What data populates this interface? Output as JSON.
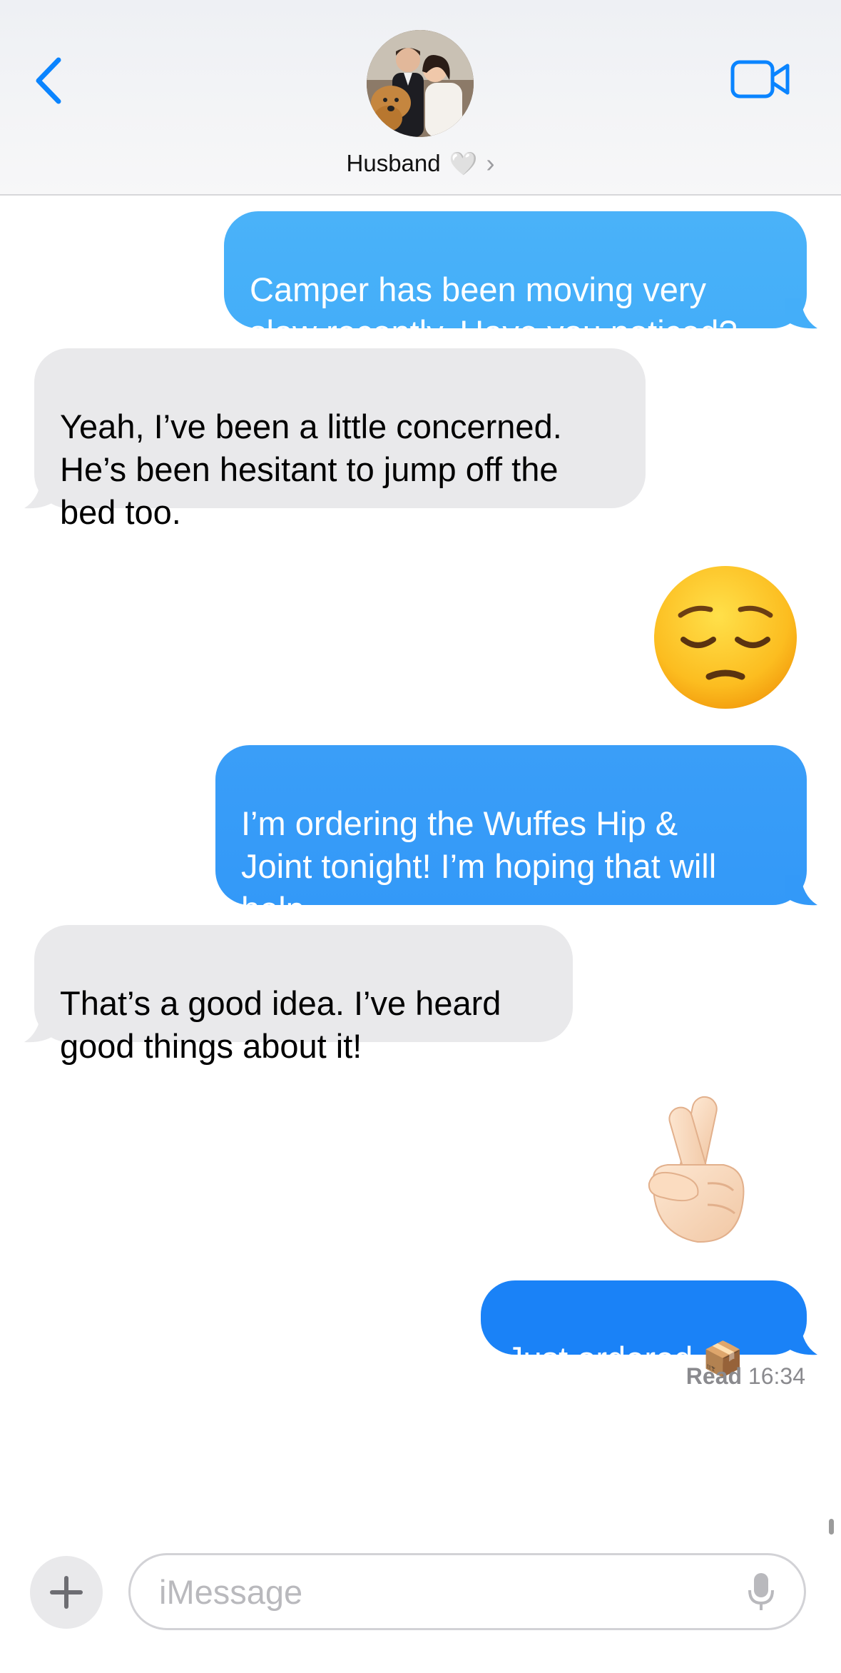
{
  "header": {
    "contact_name": "Husband",
    "contact_heart": "🤍",
    "contact_chevron": "›",
    "back_icon": "chevron-left-icon",
    "video_icon": "video-camera-icon"
  },
  "messages": [
    {
      "sender": "me",
      "text": "Camper has been moving very\nslow recently. Have you noticed?"
    },
    {
      "sender": "them",
      "text": "Yeah, I’ve been a little concerned.\nHe’s been hesitant to jump off the\nbed too."
    },
    {
      "sender": "me",
      "emoji": "😔"
    },
    {
      "sender": "me",
      "text": "I’m ordering the Wuffes Hip &\nJoint tonight! I’m hoping that will\nhelp."
    },
    {
      "sender": "them",
      "text": "That’s a good idea. I’ve heard\ngood things about it!"
    },
    {
      "sender": "me",
      "emoji": "🤞🏻"
    },
    {
      "sender": "me",
      "text": "Just ordered 📦"
    }
  ],
  "receipt": {
    "status": "Read",
    "time": "16:34"
  },
  "composer": {
    "placeholder": "iMessage",
    "plus_icon": "plus-icon",
    "mic_icon": "microphone-icon"
  },
  "colors": {
    "sent_bubble_top": "#4bb3f9",
    "sent_bubble_bottom": "#1a82f7",
    "received_bubble": "#e9e9eb",
    "ios_blue": "#0a84ff"
  }
}
